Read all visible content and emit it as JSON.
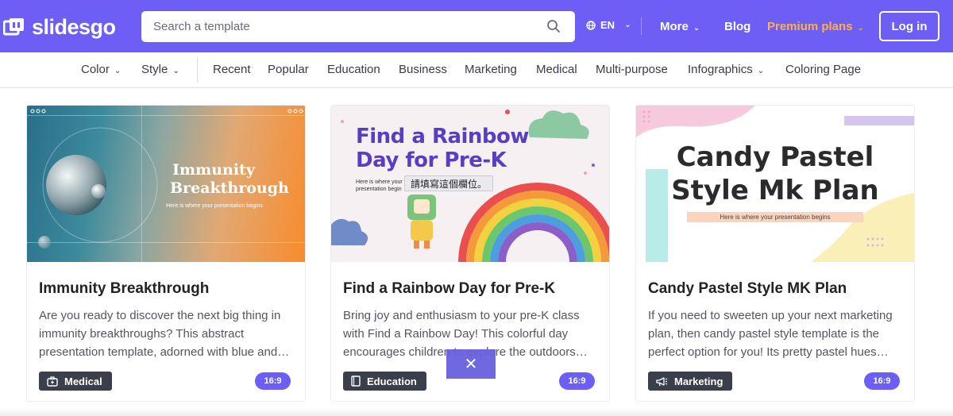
{
  "header": {
    "logo_text": "slidesgo",
    "search_placeholder": "Search a template",
    "lang": "EN",
    "more": "More",
    "blog": "Blog",
    "premium": "Premium plans",
    "login": "Log in",
    "colors": {
      "brand": "#6d5ef5",
      "premium": "#ffb13d"
    }
  },
  "categories": {
    "color": "Color",
    "style": "Style",
    "recent": "Recent",
    "popular": "Popular",
    "education": "Education",
    "business": "Business",
    "marketing": "Marketing",
    "medical": "Medical",
    "multipurpose": "Multi-purpose",
    "infographics": "Infographics",
    "coloring": "Coloring Page"
  },
  "cards": [
    {
      "thumb_title_1": "Immunity",
      "thumb_title_2": "Breakthrough",
      "thumb_subtitle": "Here is where your presentation begins",
      "title": "Immunity Breakthrough",
      "desc": "Are you ready to discover the next big thing in immunity breakthroughs? This abstract presentation template, adorned with blue and…",
      "tag": "Medical",
      "ratio": "16:9"
    },
    {
      "thumb_title_1": "Find a Rainbow",
      "thumb_title_2": "Day for Pre-K",
      "thumb_subtitle": "Here is where your presentation begin",
      "title": "Find a Rainbow Day for Pre-K",
      "desc": "Bring joy and enthusiasm to your pre-K class with Find a Rainbow Day! This colorful day encourages children to explore the outdoors…",
      "tag": "Education",
      "ratio": "16:9"
    },
    {
      "thumb_title_1": "Candy Pastel",
      "thumb_title_2": "Style Mk Plan",
      "thumb_subtitle": "Here is where your presentation begins",
      "title": "Candy Pastel Style MK Plan",
      "desc": "If you need to sweeten up your next marketing plan, then candy pastel style template is the perfect option for you! Its pretty pastel hues…",
      "tag": "Marketing",
      "ratio": "16:9"
    }
  ],
  "tooltip": "請填寫這個欄位。",
  "close_symbol": "✕"
}
